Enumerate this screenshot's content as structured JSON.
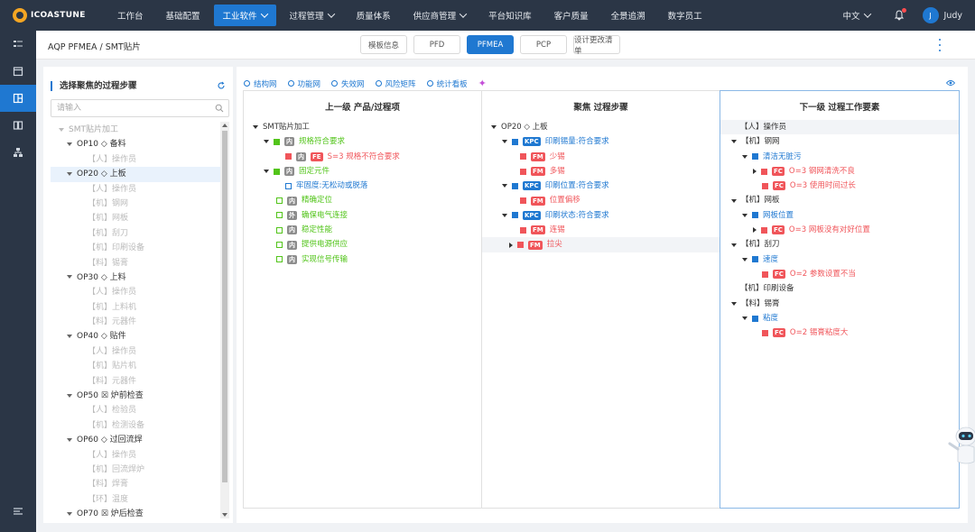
{
  "logo": {
    "text": "ICOASTUNE"
  },
  "nav": {
    "items": [
      {
        "label": "工作台",
        "caret": false,
        "active": false
      },
      {
        "label": "基础配置",
        "caret": false,
        "active": false
      },
      {
        "label": "工业软件",
        "caret": true,
        "active": true
      },
      {
        "label": "过程管理",
        "caret": true,
        "active": false
      },
      {
        "label": "质量体系",
        "caret": false,
        "active": false
      },
      {
        "label": "供应商管理",
        "caret": true,
        "active": false
      },
      {
        "label": "平台知识库",
        "caret": false,
        "active": false
      },
      {
        "label": "客户质量",
        "caret": false,
        "active": false
      },
      {
        "label": "全景追溯",
        "caret": false,
        "active": false
      },
      {
        "label": "数字员工",
        "caret": false,
        "active": false
      }
    ],
    "language": "中文",
    "user_initial": "J",
    "user_name": "Judy"
  },
  "header": {
    "breadcrumb": "AQP PFMEA / SMT贴片",
    "tabs": [
      {
        "label": "模板信息",
        "active": false,
        "width": 52
      },
      {
        "label": "PFD",
        "active": false,
        "width": 52
      },
      {
        "label": "PFMEA",
        "active": true,
        "width": 52
      },
      {
        "label": "PCP",
        "active": false,
        "width": 52
      },
      {
        "label": "设计更改清单",
        "active": false,
        "width": 52
      }
    ]
  },
  "steps_panel": {
    "title": "选择聚焦的过程步骤",
    "search_placeholder": "请输入",
    "tree": [
      {
        "type": "root",
        "label": "SMT贴片加工"
      },
      {
        "type": "op",
        "label": "OP10 ◇ 备料"
      },
      {
        "type": "leaf",
        "label": "【人】操作员"
      },
      {
        "type": "op",
        "label": "OP20 ◇ 上板",
        "selected": true
      },
      {
        "type": "leaf",
        "label": "【人】操作员"
      },
      {
        "type": "leaf",
        "label": "【机】钢网"
      },
      {
        "type": "leaf",
        "label": "【机】网板"
      },
      {
        "type": "leaf",
        "label": "【机】刮刀"
      },
      {
        "type": "leaf",
        "label": "【机】印刷设备"
      },
      {
        "type": "leaf",
        "label": "【料】锡膏"
      },
      {
        "type": "op",
        "label": "OP30 ◇ 上料"
      },
      {
        "type": "leaf",
        "label": "【人】操作员"
      },
      {
        "type": "leaf",
        "label": "【机】上料机"
      },
      {
        "type": "leaf",
        "label": "【料】元器件"
      },
      {
        "type": "op",
        "label": "OP40 ◇ 贴件"
      },
      {
        "type": "leaf",
        "label": "【人】操作员"
      },
      {
        "type": "leaf",
        "label": "【机】贴片机"
      },
      {
        "type": "leaf",
        "label": "【料】元器件"
      },
      {
        "type": "op",
        "label": "OP50 ☒ 炉前检查"
      },
      {
        "type": "leaf",
        "label": "【人】检验员"
      },
      {
        "type": "leaf",
        "label": "【机】检测设备"
      },
      {
        "type": "op",
        "label": "OP60 ◇ 过回流焊"
      },
      {
        "type": "leaf",
        "label": "【人】操作员"
      },
      {
        "type": "leaf",
        "label": "【机】回流焊炉"
      },
      {
        "type": "leaf",
        "label": "【料】焊膏"
      },
      {
        "type": "leaf",
        "label": "【环】温度"
      },
      {
        "type": "op",
        "label": "OP70 ☒ 炉后检查"
      }
    ]
  },
  "subtabs": [
    {
      "label": "结构网"
    },
    {
      "label": "功能网"
    },
    {
      "label": "失效网"
    },
    {
      "label": "风险矩阵"
    },
    {
      "label": "统计看板"
    }
  ],
  "columns": {
    "upper": {
      "title": "上一级 产品/过程项",
      "rows": [
        {
          "indent": 10,
          "arrow": "down",
          "text": "SMT贴片加工",
          "color": "dark"
        },
        {
          "indent": 22,
          "arrow": "down",
          "sq": "green",
          "tag": "内",
          "tagc": "gray",
          "text": "规格符合要求",
          "color": "green"
        },
        {
          "indent": 46,
          "sq": "red",
          "tag": "内",
          "tagc": "gray",
          "tag2": "FE",
          "tag2c": "red",
          "text": "S=3  规格不符合要求",
          "color": "red"
        },
        {
          "indent": 22,
          "arrow": "down",
          "sq": "green",
          "tag": "内",
          "tagc": "gray",
          "text": "固定元件",
          "color": "green"
        },
        {
          "indent": 46,
          "sq": "outline-blue",
          "text": "牢固度:无松动或脱落",
          "color": "blue"
        },
        {
          "indent": 36,
          "sq": "outline-green",
          "tag": "内",
          "tagc": "gray",
          "text": "精确定位",
          "color": "green"
        },
        {
          "indent": 36,
          "sq": "outline-green",
          "tag": "外",
          "tagc": "gray",
          "text": "确保电气连接",
          "color": "green"
        },
        {
          "indent": 36,
          "sq": "outline-green",
          "tag": "内",
          "tagc": "gray",
          "text": "稳定性能",
          "color": "green"
        },
        {
          "indent": 36,
          "sq": "outline-green",
          "tag": "内",
          "tagc": "gray",
          "text": "提供电源供应",
          "color": "green"
        },
        {
          "indent": 36,
          "sq": "outline-green",
          "tag": "内",
          "tagc": "gray",
          "text": "实现信号传输",
          "color": "green"
        }
      ]
    },
    "focus": {
      "title": "聚焦 过程步骤",
      "rows": [
        {
          "indent": 10,
          "arrow": "down",
          "text": "OP20 ◇ 上板",
          "color": "dark"
        },
        {
          "indent": 22,
          "arrow": "down",
          "sq": "blue",
          "tag": "KPC",
          "tagc": "blue",
          "text": "印刷锡量:符合要求",
          "color": "blue"
        },
        {
          "indent": 42,
          "sq": "red",
          "tag": "FM",
          "tagc": "red",
          "text": "少锡",
          "color": "red"
        },
        {
          "indent": 42,
          "sq": "red",
          "tag": "FM",
          "tagc": "red",
          "text": "多锡",
          "color": "red"
        },
        {
          "indent": 22,
          "arrow": "down",
          "sq": "blue",
          "tag": "KPC",
          "tagc": "blue",
          "text": "印刷位置:符合要求",
          "color": "blue"
        },
        {
          "indent": 42,
          "sq": "red",
          "tag": "FM",
          "tagc": "red",
          "text": "位置偏移",
          "color": "red"
        },
        {
          "indent": 22,
          "arrow": "down",
          "sq": "blue",
          "tag": "KPC",
          "tagc": "blue",
          "text": "印刷状态:符合要求",
          "color": "blue"
        },
        {
          "indent": 42,
          "sq": "red",
          "tag": "FM",
          "tagc": "red",
          "text": "连锡",
          "color": "red"
        },
        {
          "indent": 30,
          "arrow": "right",
          "sq": "red",
          "tag": "FM",
          "tagc": "red",
          "text": "拉尖",
          "color": "red",
          "hl": true
        }
      ]
    },
    "lower": {
      "title": "下一级 过程工作要素",
      "rows": [
        {
          "indent": 22,
          "text": "【人】操作员",
          "color": "dark",
          "hl": true
        },
        {
          "indent": 12,
          "arrow": "down",
          "text": "【机】钢网",
          "color": "dark"
        },
        {
          "indent": 24,
          "arrow": "down",
          "sq": "blue",
          "text": "清洁无脏污",
          "color": "blue"
        },
        {
          "indent": 36,
          "arrow": "right",
          "sq": "red",
          "tag": "FC",
          "tagc": "red",
          "text": "O=3  钢网清洗不良",
          "color": "red"
        },
        {
          "indent": 46,
          "sq": "red",
          "tag": "FC",
          "tagc": "red",
          "text": "O=3  使用时间过长",
          "color": "red"
        },
        {
          "indent": 12,
          "arrow": "down",
          "text": "【机】网板",
          "color": "dark"
        },
        {
          "indent": 24,
          "arrow": "down",
          "sq": "blue",
          "text": "网板位置",
          "color": "blue"
        },
        {
          "indent": 36,
          "arrow": "right",
          "sq": "red",
          "tag": "FC",
          "tagc": "red",
          "text": "O=3  网板没有对好位置",
          "color": "red"
        },
        {
          "indent": 12,
          "arrow": "down",
          "text": "【机】刮刀",
          "color": "dark"
        },
        {
          "indent": 24,
          "arrow": "down",
          "sq": "blue",
          "text": "速度",
          "color": "blue"
        },
        {
          "indent": 46,
          "sq": "red",
          "tag": "FC",
          "tagc": "red",
          "text": "O=2  参数设置不当",
          "color": "red"
        },
        {
          "indent": 22,
          "text": "【机】印刷设备",
          "color": "dark"
        },
        {
          "indent": 12,
          "arrow": "down",
          "text": "【料】锡膏",
          "color": "dark"
        },
        {
          "indent": 24,
          "arrow": "down",
          "sq": "blue",
          "text": "粘度",
          "color": "blue"
        },
        {
          "indent": 46,
          "sq": "red",
          "tag": "FC",
          "tagc": "red",
          "text": "O=2  锡膏粘度大",
          "color": "red"
        }
      ]
    }
  }
}
